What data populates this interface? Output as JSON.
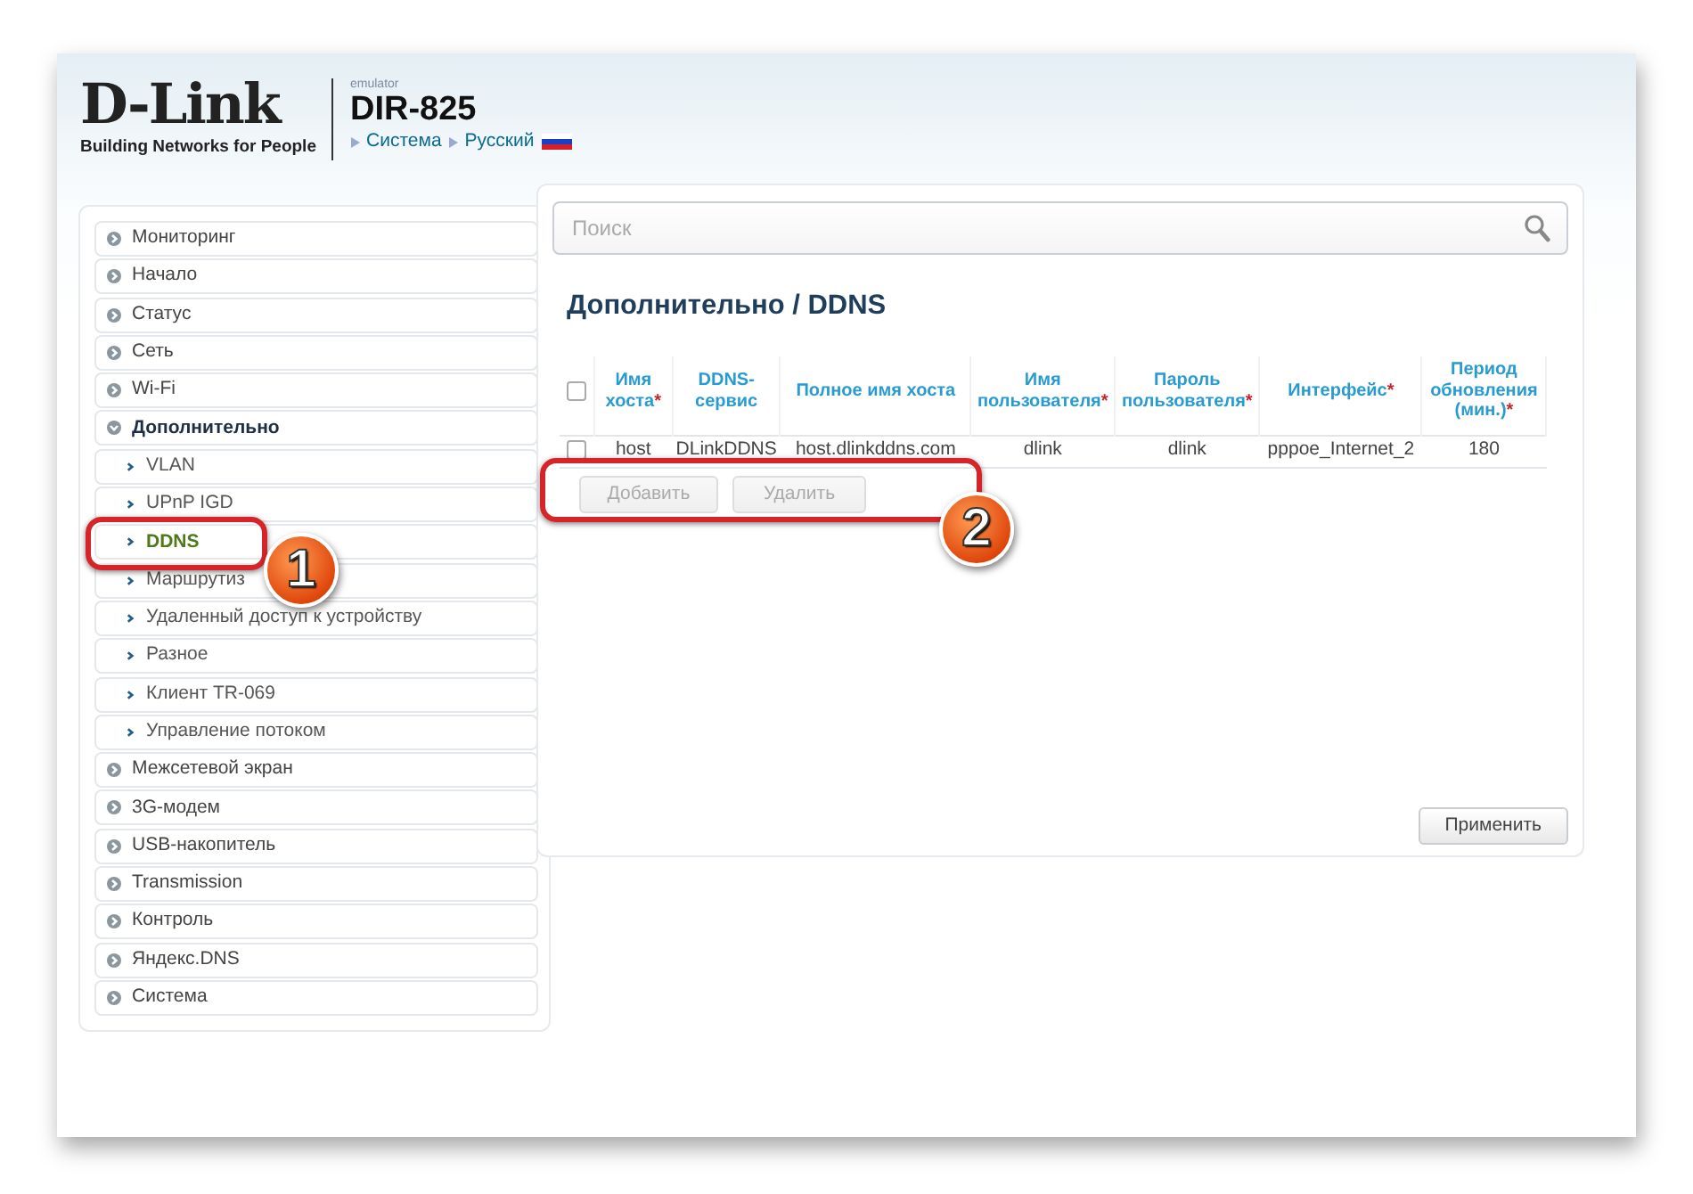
{
  "header": {
    "brand": "D-Link",
    "tagline": "Building Networks for People",
    "emulator": "emulator",
    "model": "DIR-825",
    "breadcrumb": [
      "Система",
      "Русский"
    ]
  },
  "sidebar": {
    "items": [
      {
        "label": "Мониторинг",
        "expanded": false,
        "selected": false
      },
      {
        "label": "Начало",
        "expanded": false,
        "selected": false
      },
      {
        "label": "Статус",
        "expanded": false,
        "selected": false
      },
      {
        "label": "Сеть",
        "expanded": false,
        "selected": false
      },
      {
        "label": "Wi-Fi",
        "expanded": false,
        "selected": false
      },
      {
        "label": "Дополнительно",
        "expanded": true,
        "selected": false,
        "children": [
          {
            "label": "VLAN",
            "selected": false
          },
          {
            "label": "UPnP IGD",
            "selected": false
          },
          {
            "label": "DDNS",
            "selected": true
          },
          {
            "label": "Маршрутиз",
            "selected": false
          },
          {
            "label": "Удаленный доступ к устройству",
            "selected": false
          },
          {
            "label": "Разное",
            "selected": false
          },
          {
            "label": "Клиент TR-069",
            "selected": false
          },
          {
            "label": "Управление потоком",
            "selected": false
          }
        ]
      },
      {
        "label": "Межсетевой экран",
        "expanded": false,
        "selected": false
      },
      {
        "label": "3G-модем",
        "expanded": false,
        "selected": false
      },
      {
        "label": "USB-накопитель",
        "expanded": false,
        "selected": false
      },
      {
        "label": "Transmission",
        "expanded": false,
        "selected": false
      },
      {
        "label": "Контроль",
        "expanded": false,
        "selected": false
      },
      {
        "label": "Яндекс.DNS",
        "expanded": false,
        "selected": false
      },
      {
        "label": "Система",
        "expanded": false,
        "selected": false
      }
    ]
  },
  "search": {
    "placeholder": "Поиск"
  },
  "page_title": "Дополнительно /  DDNS",
  "table": {
    "all_checked": false,
    "columns": [
      {
        "label": "Имя хоста",
        "mark": "*"
      },
      {
        "label": "DDNS-сервис"
      },
      {
        "label": "Полное имя хоста"
      },
      {
        "label": "Имя пользователя",
        "mark": "*"
      },
      {
        "label": "Пароль пользователя",
        "mark": "*"
      },
      {
        "label": "Интерфейс",
        "mark": "*"
      },
      {
        "label": "Период обновления (мин.)",
        "mark": "*"
      }
    ],
    "rows": [
      {
        "checked": false,
        "cells": [
          "host",
          "DLinkDDNS",
          "host.dlinkddns.com",
          "dlink",
          "dlink",
          "pppoe_Internet_2",
          "180"
        ]
      }
    ]
  },
  "buttons": [
    {
      "label": "Добавить",
      "disabled": true
    },
    {
      "label": "Удалить",
      "disabled": true
    }
  ],
  "apply_button": {
    "label": "Применить",
    "disabled": false
  },
  "callouts": [
    {
      "number": "1"
    },
    {
      "number": "2"
    }
  ]
}
